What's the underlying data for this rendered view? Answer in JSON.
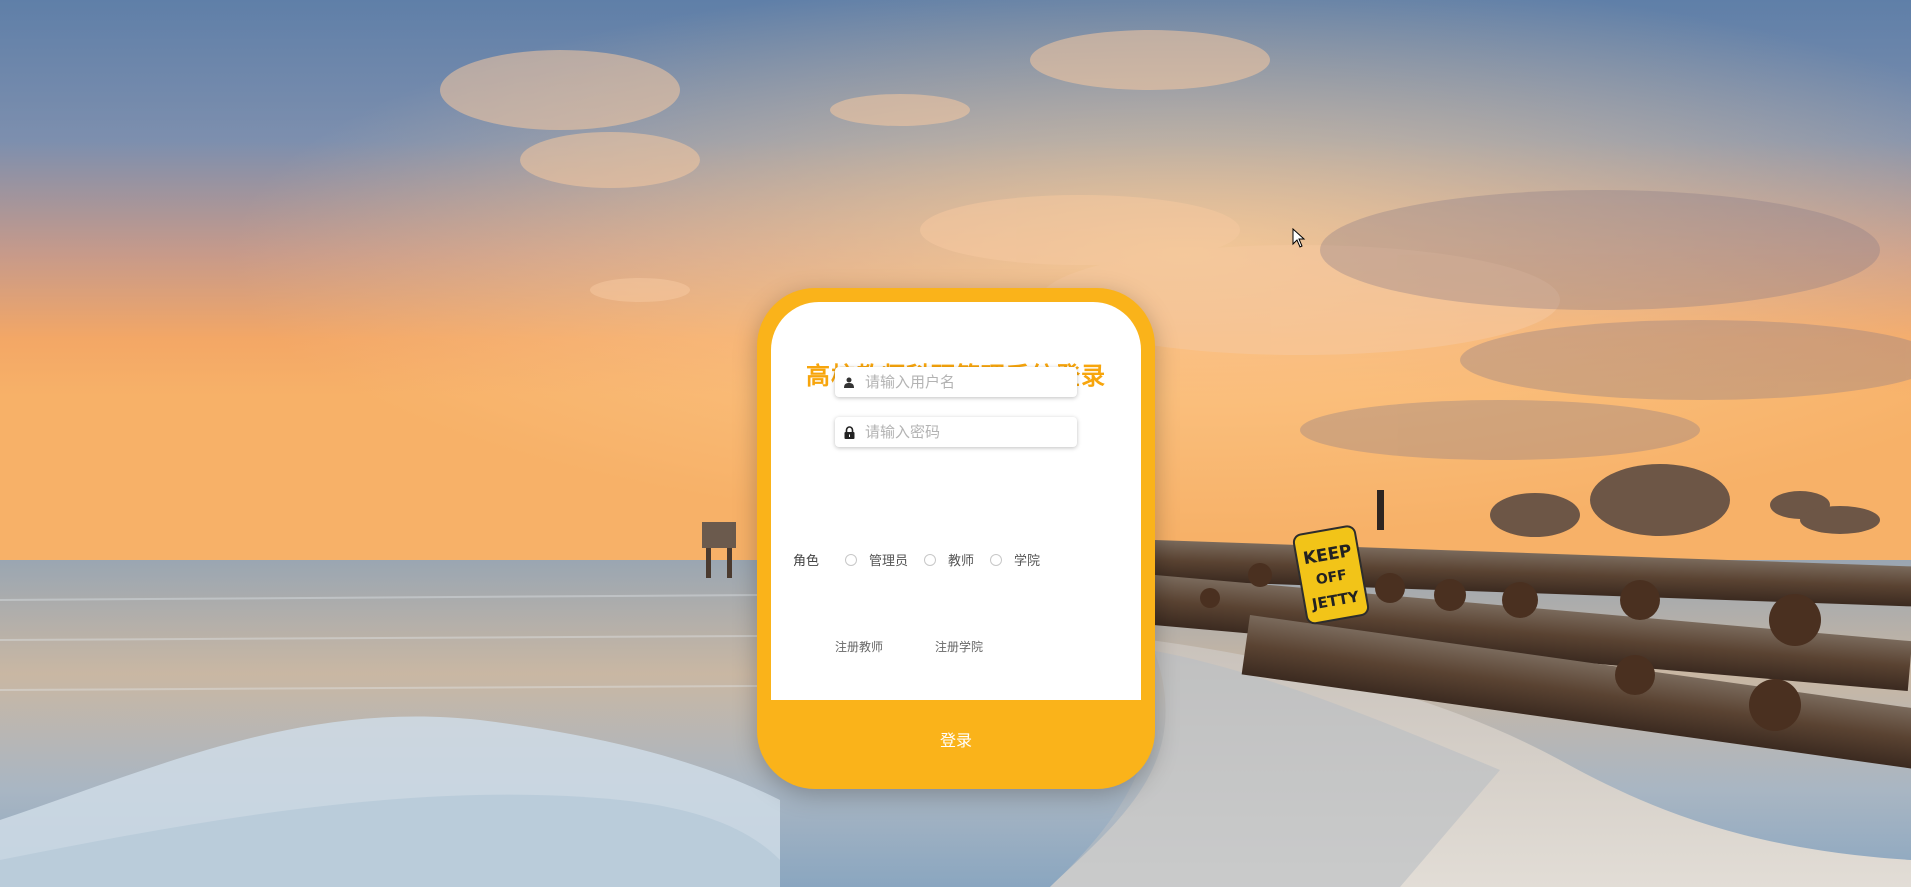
{
  "login": {
    "title": "高校教师科研管理系统登录",
    "username_placeholder": "请输入用户名",
    "password_placeholder": "请输入密码",
    "role_label": "角色",
    "roles": [
      "管理员",
      "教师",
      "学院"
    ],
    "register_teacher": "注册教师",
    "register_college": "注册学院",
    "login_button": "登录"
  },
  "theme": {
    "accent": "#fab31a",
    "title_color": "#f7a50c",
    "card_background": "#ffffff"
  },
  "icons": {
    "username": "user-icon",
    "password": "lock-icon"
  },
  "background": "sunset-beach-with-jetty-photo",
  "sign_text": [
    "KEEP",
    "OFF",
    "JETTY"
  ]
}
